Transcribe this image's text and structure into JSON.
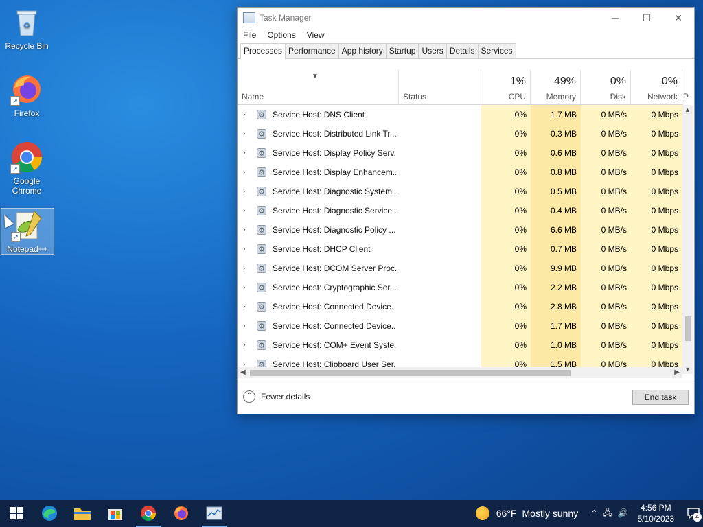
{
  "desktop": {
    "icons": [
      {
        "label": "Recycle Bin"
      },
      {
        "label": "Firefox"
      },
      {
        "label": "Google Chrome"
      },
      {
        "label": "Notepad++"
      }
    ]
  },
  "window": {
    "title": "Task Manager",
    "menu": [
      "File",
      "Options",
      "View"
    ],
    "tabs": [
      "Processes",
      "Performance",
      "App history",
      "Startup",
      "Users",
      "Details",
      "Services"
    ],
    "active_tab": "Processes",
    "columns": {
      "name": "Name",
      "status": "Status",
      "cpu": {
        "pct": "1%",
        "label": "CPU"
      },
      "memory": {
        "pct": "49%",
        "label": "Memory"
      },
      "disk": {
        "pct": "0%",
        "label": "Disk"
      },
      "network": {
        "pct": "0%",
        "label": "Network"
      },
      "power": "P"
    },
    "rows": [
      {
        "name": "Service Host: DNS Client",
        "cpu": "0%",
        "mem": "1.7 MB",
        "disk": "0 MB/s",
        "net": "0 Mbps"
      },
      {
        "name": "Service Host: Distributed Link Tr...",
        "cpu": "0%",
        "mem": "0.3 MB",
        "disk": "0 MB/s",
        "net": "0 Mbps"
      },
      {
        "name": "Service Host: Display Policy Serv...",
        "cpu": "0%",
        "mem": "0.6 MB",
        "disk": "0 MB/s",
        "net": "0 Mbps"
      },
      {
        "name": "Service Host: Display Enhancem...",
        "cpu": "0%",
        "mem": "0.8 MB",
        "disk": "0 MB/s",
        "net": "0 Mbps"
      },
      {
        "name": "Service Host: Diagnostic System...",
        "cpu": "0%",
        "mem": "0.5 MB",
        "disk": "0 MB/s",
        "net": "0 Mbps"
      },
      {
        "name": "Service Host: Diagnostic Service...",
        "cpu": "0%",
        "mem": "0.4 MB",
        "disk": "0 MB/s",
        "net": "0 Mbps"
      },
      {
        "name": "Service Host: Diagnostic Policy ...",
        "cpu": "0%",
        "mem": "6.6 MB",
        "disk": "0 MB/s",
        "net": "0 Mbps"
      },
      {
        "name": "Service Host: DHCP Client",
        "cpu": "0%",
        "mem": "0.7 MB",
        "disk": "0 MB/s",
        "net": "0 Mbps"
      },
      {
        "name": "Service Host: DCOM Server Proc...",
        "cpu": "0%",
        "mem": "9.9 MB",
        "disk": "0 MB/s",
        "net": "0 Mbps"
      },
      {
        "name": "Service Host: Cryptographic Ser...",
        "cpu": "0%",
        "mem": "2.2 MB",
        "disk": "0 MB/s",
        "net": "0 Mbps"
      },
      {
        "name": "Service Host: Connected Device...",
        "cpu": "0%",
        "mem": "2.8 MB",
        "disk": "0 MB/s",
        "net": "0 Mbps"
      },
      {
        "name": "Service Host: Connected Device...",
        "cpu": "0%",
        "mem": "1.7 MB",
        "disk": "0 MB/s",
        "net": "0 Mbps"
      },
      {
        "name": "Service Host: COM+ Event Syste...",
        "cpu": "0%",
        "mem": "1.0 MB",
        "disk": "0 MB/s",
        "net": "0 Mbps"
      },
      {
        "name": "Service Host: Clipboard User Ser...",
        "cpu": "0%",
        "mem": "1.5 MB",
        "disk": "0 MB/s",
        "net": "0 Mbps"
      }
    ],
    "footer": {
      "fewer_details": "Fewer details",
      "end_task": "End task"
    }
  },
  "taskbar": {
    "weather": {
      "temp": "66°F",
      "desc": "Mostly sunny"
    },
    "clock": {
      "time": "4:56 PM",
      "date": "5/10/2023"
    },
    "notifications": "4"
  },
  "colors": {
    "cpu_heat": "#fff4c4",
    "mem_heat": "#fce9a5",
    "taskbar": "#102445",
    "accent": "#1a5fb4"
  }
}
